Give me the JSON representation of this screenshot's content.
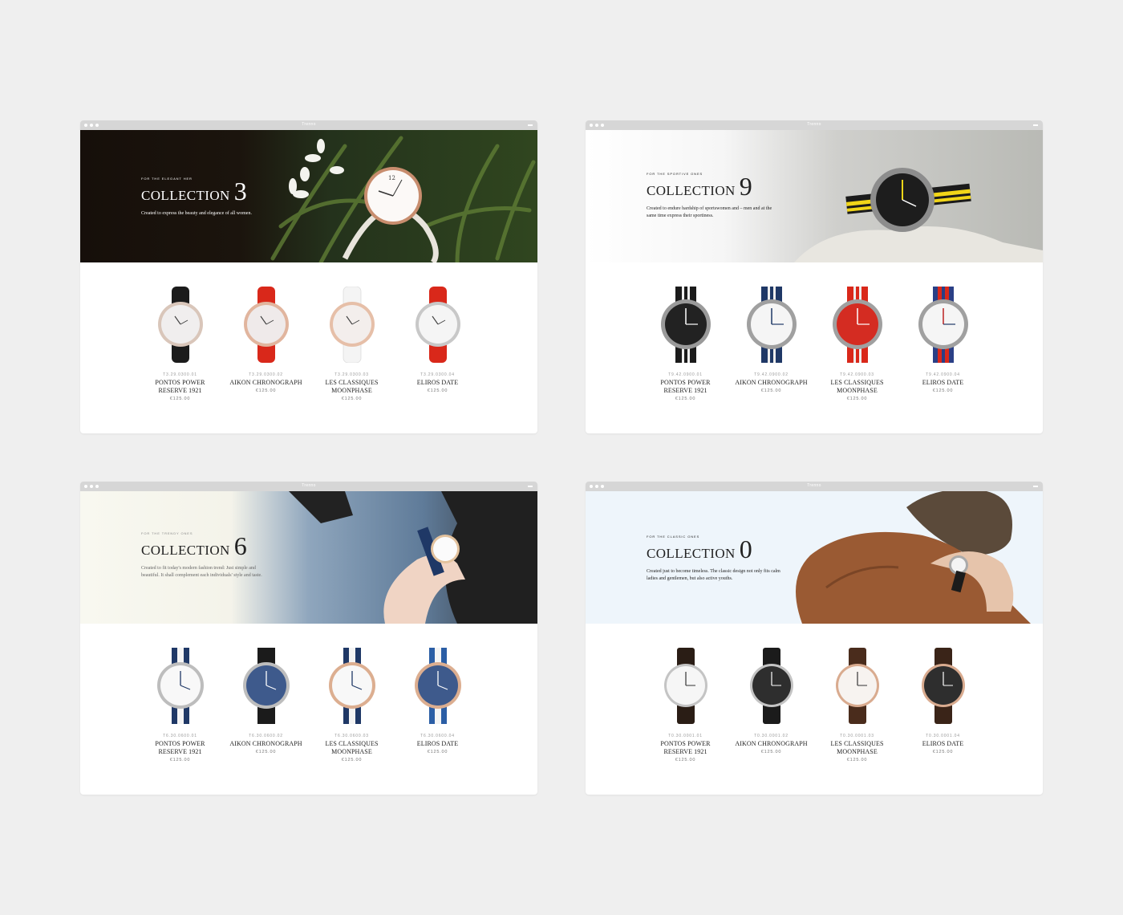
{
  "windows": [
    {
      "tab": "Trenno",
      "hero": {
        "kicker": "FOR THE ELEGANT HER",
        "title": "COLLECTION",
        "number": "3",
        "description": "Created to express the beauty and elegance of all women."
      },
      "products": [
        {
          "sku": "T3.29.0300.01",
          "name_1": "PONTOS POWER",
          "name_2": "RESERVE 1921",
          "price": "€125.00"
        },
        {
          "sku": "T3.29.0300.02",
          "name_1": "AIKON CHRONOGRAPH",
          "name_2": "",
          "price": "€125.00"
        },
        {
          "sku": "T3.29.0300.03",
          "name_1": "LES CLASSIQUES",
          "name_2": "MOONPHASE",
          "price": "€125.00"
        },
        {
          "sku": "T3.29.0300.04",
          "name_1": "ELIROS DATE",
          "name_2": "",
          "price": "€125.00"
        }
      ]
    },
    {
      "tab": "Trenno",
      "hero": {
        "kicker": "FOR THE SPORTIVE ONES",
        "title": "COLLECTION",
        "number": "9",
        "description": "Created to endure hardship of sportswomen and – men and at the same time express their sportiness."
      },
      "products": [
        {
          "sku": "T9.42.0900.01",
          "name_1": "PONTOS POWER",
          "name_2": "RESERVE 1921",
          "price": "€125.00"
        },
        {
          "sku": "T9.42.0900.02",
          "name_1": "AIKON CHRONOGRAPH",
          "name_2": "",
          "price": "€125.00"
        },
        {
          "sku": "T9.42.0900.03",
          "name_1": "LES CLASSIQUES",
          "name_2": "MOONPHASE",
          "price": "€125.00"
        },
        {
          "sku": "T9.42.0900.04",
          "name_1": "ELIROS DATE",
          "name_2": "",
          "price": "€125.00"
        }
      ]
    },
    {
      "tab": "Trenno",
      "hero": {
        "kicker": "FOR THE TRENDY ONES",
        "title": "COLLECTION",
        "number": "6",
        "description": "Created to fit today's modern fashion trend: Just simple and beautiful. It shall complement each individuals' style and taste."
      },
      "products": [
        {
          "sku": "T6.30.0600.01",
          "name_1": "PONTOS POWER",
          "name_2": "RESERVE 1921",
          "price": "€125.00"
        },
        {
          "sku": "T6.30.0600.02",
          "name_1": "AIKON CHRONOGRAPH",
          "name_2": "",
          "price": "€125.00"
        },
        {
          "sku": "T6.30.0600.03",
          "name_1": "LES CLASSIQUES",
          "name_2": "MOONPHASE",
          "price": "€125.00"
        },
        {
          "sku": "T6.30.0600.04",
          "name_1": "ELIROS DATE",
          "name_2": "",
          "price": "€125.00"
        }
      ]
    },
    {
      "tab": "Trenno",
      "hero": {
        "kicker": "FOR THE CLASSIC ONES",
        "title": "COLLECTION",
        "number": "0",
        "description": "Created just to become timeless. The classic design not only fits calm ladies and gentlemen, but also active youths."
      },
      "products": [
        {
          "sku": "T0.30.0001.01",
          "name_1": "PONTOS POWER",
          "name_2": "RESERVE 1921",
          "price": "€125.00"
        },
        {
          "sku": "T0.30.0001.02",
          "name_1": "AIKON CHRONOGRAPH",
          "name_2": "",
          "price": "€125.00"
        },
        {
          "sku": "T0.30.0001.03",
          "name_1": "LES CLASSIQUES",
          "name_2": "MOONPHASE",
          "price": "€125.00"
        },
        {
          "sku": "T0.30.0001.04",
          "name_1": "ELIROS DATE",
          "name_2": "",
          "price": "€125.00"
        }
      ]
    }
  ],
  "colors": {
    "page_background": "#efefef",
    "titlebar": "#d6d6d6",
    "hero_dark_bg": "#1a130d",
    "hero_light_bg": "#ffffff",
    "hero_cream_bg": "#f8f8f0",
    "hero_blue_bg": "#eef5fb",
    "strap_red": "#d9281a",
    "strap_black": "#1b1b1b",
    "strap_navy": "#1f3866",
    "strap_brown": "#3a2418"
  }
}
